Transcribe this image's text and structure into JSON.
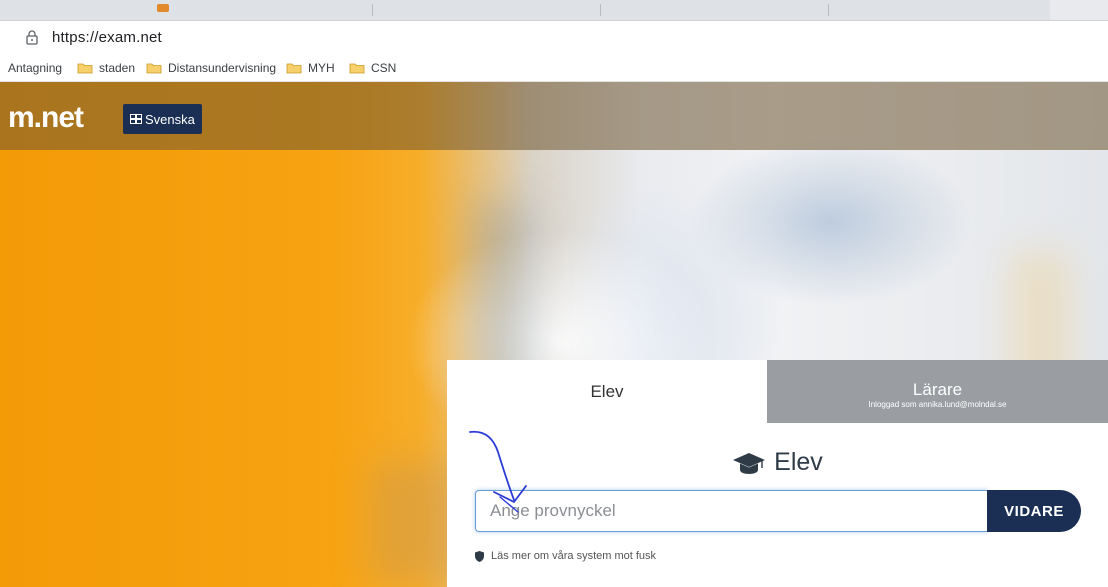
{
  "browser": {
    "url": "https://exam.net",
    "bookmarks": [
      {
        "label": "Antagning",
        "folder": false
      },
      {
        "label": "staden",
        "folder": true
      },
      {
        "label": "Distansundervisning",
        "folder": true
      },
      {
        "label": "MYH",
        "folder": true
      },
      {
        "label": "CSN",
        "folder": true
      }
    ]
  },
  "site": {
    "logo": "m.net",
    "language_button": "Svenska"
  },
  "login": {
    "tab_student": "Elev",
    "tab_teacher": "Lärare",
    "teacher_status": "Inloggad som annika.lund@molndal.se",
    "heading": "Elev",
    "key_placeholder": "Ange provnyckel",
    "submit_label": "VIDARE",
    "anti_cheat_link": "Läs mer om våra system mot fusk"
  },
  "colors": {
    "navy": "#1b2f55",
    "orange": "#f39a07",
    "tab_gray": "#9a9da2",
    "annotation_blue": "#2b3bd6"
  },
  "icons": {
    "lock": "lock-icon",
    "folder": "folder-icon",
    "flag": "flag-icon",
    "cap": "graduation-cap-icon",
    "shield": "shield-icon"
  }
}
